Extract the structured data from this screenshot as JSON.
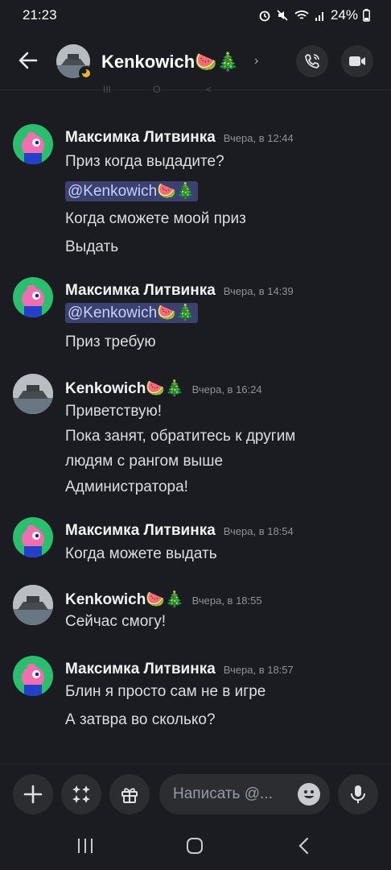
{
  "status_bar": {
    "time": "21:23",
    "battery": "24%"
  },
  "header": {
    "title": "Kenkowich🍉🎄",
    "chevron": "›"
  },
  "ghost_bar": {
    "a": "III",
    "b": "O",
    "c": "<"
  },
  "messages": [
    {
      "author": "Максимка Литвинка",
      "time": "Вчера, в 12:44",
      "avatar": "green-avatar",
      "lines": [
        "Приз когда выдадите?",
        "@Kenkowich🍉🎄",
        "Когда сможете моой приз",
        "Выдать"
      ]
    },
    {
      "author": "Максимка Литвинка",
      "time": "Вчера, в 14:39",
      "avatar": "green-avatar",
      "lines": [
        "@Kenkowich🍉🎄",
        "Приз требую"
      ]
    },
    {
      "author": "Kenkowich🍉🎄",
      "time": "Вчера, в 16:24",
      "avatar": "gray-avatar",
      "lines": [
        "Приветствую!",
        "Пока занят, обратитесь к другим",
        "людям с рангом выше",
        "Администратора!"
      ]
    },
    {
      "author": "Максимка Литвинка",
      "time": "Вчера, в 18:54",
      "avatar": "green-avatar",
      "lines": [
        "Когда можете выдать"
      ]
    },
    {
      "author": "Kenkowich🍉🎄",
      "time": "Вчера, в 18:55",
      "avatar": "gray-avatar",
      "lines": [
        "Сейчас смогу!"
      ]
    },
    {
      "author": "Максимка Литвинка",
      "time": "Вчера, в 18:57",
      "avatar": "green-avatar",
      "lines": [
        "Блин я просто сам не в игре",
        "А затвра во сколько?"
      ]
    }
  ],
  "composer": {
    "placeholder": "Написать @..."
  },
  "icons": {
    "back": "arrow-left-icon",
    "call": "phone-icon",
    "video": "video-camera-icon",
    "plus": "plus-icon",
    "apps": "apps-icon",
    "gift": "gift-icon",
    "emoji": "smiley-icon",
    "mic": "microphone-icon"
  },
  "colors": {
    "background": "#1b1c21",
    "mention_bg": "#3c4270",
    "mention_text": "#c9cdfb",
    "button_bg": "#2b2d31"
  }
}
